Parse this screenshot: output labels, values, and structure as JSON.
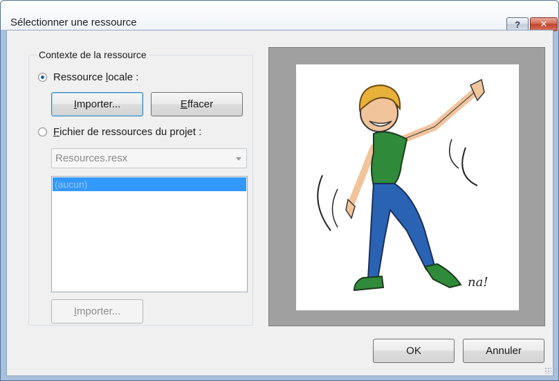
{
  "window": {
    "title": "Sélectionner une ressource",
    "help_label": "?",
    "close_label": "✕"
  },
  "context_group": {
    "label": "Contexte de la ressource",
    "local_resource": {
      "label_pre": "Ressource ",
      "label_accel": "l",
      "label_post": "ocale :",
      "checked": true
    },
    "import_button": {
      "pre": "",
      "accel": "I",
      "post": "mporter..."
    },
    "clear_button": {
      "pre": "",
      "accel": "E",
      "post": "ffacer"
    },
    "project_resource": {
      "label_pre": "",
      "label_accel": "F",
      "label_post": "ichier de ressources du projet :",
      "checked": false
    },
    "resx_combo": {
      "value": "Resources.resx"
    },
    "resource_list": {
      "items": [
        "(aucun)"
      ],
      "selected_index": 0
    },
    "import_project_button": {
      "pre": "",
      "accel": "I",
      "post": "mporter..."
    }
  },
  "footer": {
    "ok_label": "OK",
    "cancel_label": "Annuler"
  },
  "colors": {
    "shirt": "#2f8a3a",
    "jeans": "#2a63b4",
    "hair": "#e8b13a",
    "skin": "#f1c49c",
    "selection": "#3399ff"
  }
}
